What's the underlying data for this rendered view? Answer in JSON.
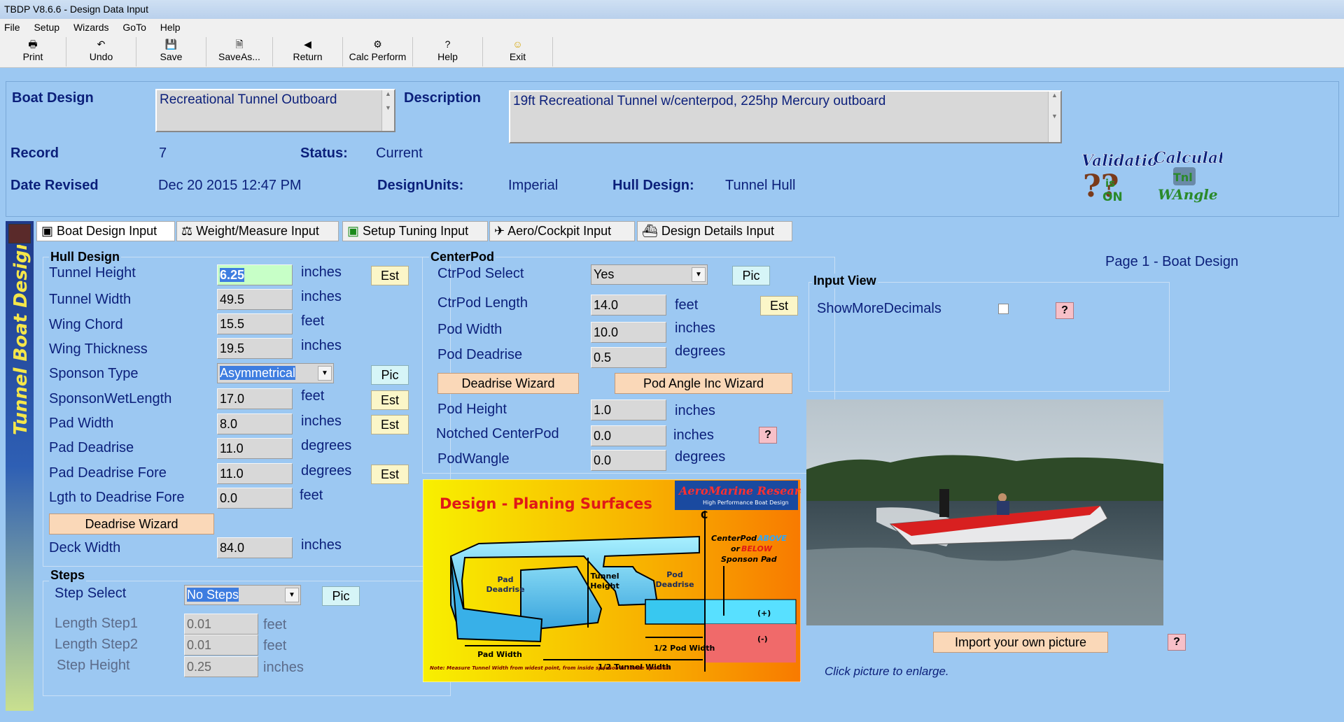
{
  "window": {
    "title": "TBDP V8.6.6 - Design Data Input"
  },
  "menu": [
    "File",
    "Setup",
    "Wizards",
    "GoTo",
    "Help"
  ],
  "toolbar": [
    {
      "label": "Print",
      "icon": "printer-icon",
      "glyph": "🖶"
    },
    {
      "label": "Undo",
      "icon": "undo-icon",
      "glyph": "↶"
    },
    {
      "label": "Save",
      "icon": "save-icon",
      "glyph": "💾"
    },
    {
      "label": "SaveAs...",
      "icon": "save-as-icon",
      "glyph": "🗎"
    },
    {
      "label": "Return",
      "icon": "return-icon",
      "glyph": "◀"
    },
    {
      "label": "Calc Perform",
      "icon": "calc-icon",
      "glyph": "⚙"
    },
    {
      "label": "Help",
      "icon": "help-icon",
      "glyph": "?"
    },
    {
      "label": "Exit",
      "icon": "smiley-icon",
      "glyph": "☺"
    }
  ],
  "header": {
    "boat_design_label": "Boat Design",
    "boat_design_value": "Recreational Tunnel Outboard",
    "description_label": "Description",
    "description_value": "19ft Recreational Tunnel w/centerpod, 225hp Mercury outboard",
    "record_label": "Record",
    "record_value": "7",
    "status_label": "Status:",
    "status_value": "Current",
    "date_label": "Date Revised",
    "date_value": "Dec 20 2015 12:47 PM",
    "units_label": "DesignUnits:",
    "units_value": "Imperial",
    "hull_label": "Hull Design:",
    "hull_value": "Tunnel Hull",
    "validation_logo": "Validation is ON",
    "calculate_logo": "Calculate Tnl WAngle"
  },
  "tabs": [
    "Boat Design Input",
    "Weight/Measure Input",
    "Setup Tuning Input",
    "Aero/Cockpit Input",
    "Design Details Input"
  ],
  "side_banner": "Tunnel Boat Design",
  "hull": {
    "title": "Hull Design",
    "rows": [
      {
        "label": "Tunnel Height",
        "value": "6.25",
        "unit": "inches",
        "button": "Est"
      },
      {
        "label": "Tunnel Width",
        "value": "49.5",
        "unit": "inches"
      },
      {
        "label": "Wing Chord",
        "value": "15.5",
        "unit": "feet"
      },
      {
        "label": "Wing Thickness",
        "value": "19.5",
        "unit": "inches"
      },
      {
        "label": "Sponson Type",
        "value": "Asymmetrical",
        "button": "Pic"
      },
      {
        "label": "SponsonWetLength",
        "value": "17.0",
        "unit": "feet",
        "button": "Est"
      },
      {
        "label": "Pad Width",
        "value": "8.0",
        "unit": "inches",
        "button": "Est"
      },
      {
        "label": "Pad Deadrise",
        "value": "11.0",
        "unit": "degrees"
      },
      {
        "label": "Pad Deadrise Fore",
        "value": "11.0",
        "unit": "degrees",
        "button": "Est"
      },
      {
        "label": "Lgth to Deadrise Fore",
        "value": "0.0",
        "unit": "feet"
      },
      {
        "label": "Deck Width",
        "value": "84.0",
        "unit": "inches"
      }
    ],
    "wizard_button": "Deadrise Wizard"
  },
  "steps": {
    "title": "Steps",
    "select_label": "Step Select",
    "select_value": "No Steps",
    "pic_button": "Pic",
    "rows": [
      {
        "label": "Length Step1",
        "value": "0.01",
        "unit": "feet"
      },
      {
        "label": "Length Step2",
        "value": "0.01",
        "unit": "feet"
      },
      {
        "label": "Step Height",
        "value": "0.25",
        "unit": "inches"
      }
    ]
  },
  "centerpod": {
    "title": "CenterPod",
    "select_label": "CtrPod Select",
    "select_value": "Yes",
    "pic_button": "Pic",
    "est_button": "Est",
    "rows": [
      {
        "label": "CtrPod Length",
        "value": "14.0",
        "unit": "feet"
      },
      {
        "label": "Pod Width",
        "value": "10.0",
        "unit": "inches"
      },
      {
        "label": "Pod Deadrise",
        "value": "0.5",
        "unit": "degrees"
      },
      {
        "label": "Pod Height",
        "value": "1.0",
        "unit": "inches"
      },
      {
        "label": "Notched CenterPod",
        "value": "0.0",
        "unit": "inches"
      },
      {
        "label": "PodWangle",
        "value": "0.0",
        "unit": "degrees"
      }
    ],
    "deadrise_wizard": "Deadrise Wizard",
    "pod_angle_wizard": "Pod Angle Inc Wizard",
    "help_button": "?"
  },
  "diagram": {
    "title": "Design - Planing Surfaces",
    "brand": "AeroMarine Research",
    "brand_sub": "High Performance Boat Design",
    "pad_deadrise": "Pad Deadrise",
    "tunnel_height": "Tunnel Height",
    "pod_deadrise": "Pod Deadrise",
    "centerpod_note_1": "CenterPod",
    "centerpod_note_2": "ABOVE",
    "centerpod_note_3": "or",
    "centerpod_note_4": "BELOW",
    "centerpod_note_5": "Sponson Pad",
    "pad_width": "Pad Width",
    "half_pod_width": "1/2 Pod Width",
    "half_tunnel_width": "1/2 Tunnel Width",
    "plus": "(+)",
    "minus": "(-)",
    "cl": "C",
    "note": "Note: Measure Tunnel Width from widest point, from inside sponson to inside sponson"
  },
  "page_label": "Page 1 - Boat Design",
  "input_view": {
    "title": "Input View",
    "show_more_label": "ShowMoreDecimals",
    "help_button": "?"
  },
  "picture": {
    "import_button": "Import your own picture",
    "help_button": "?",
    "caption": "Click picture to enlarge."
  }
}
